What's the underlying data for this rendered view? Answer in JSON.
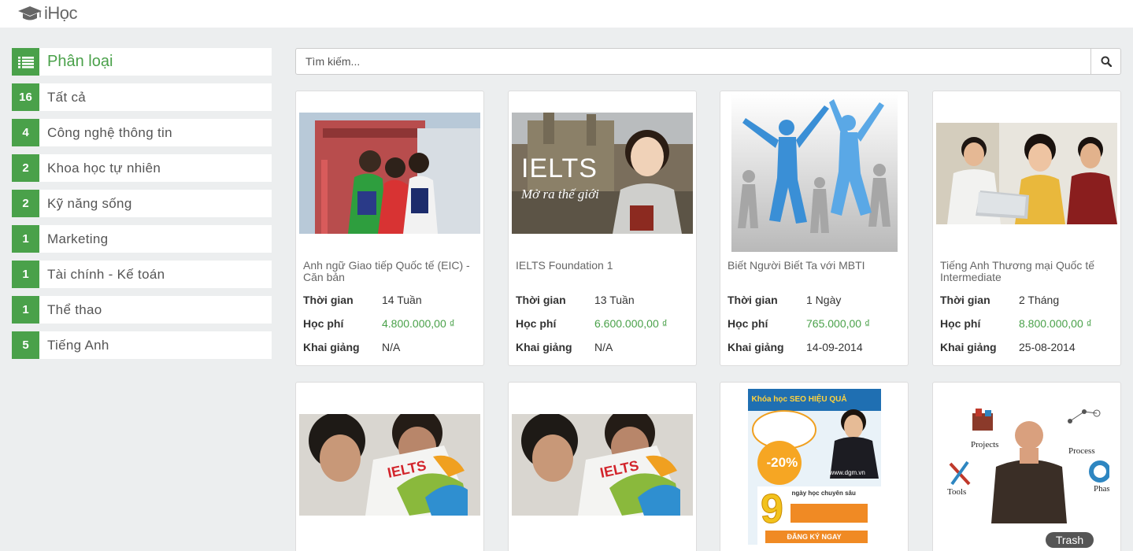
{
  "app": {
    "logo_text": "iHọc"
  },
  "sidebar": {
    "header": "Phân loại",
    "items": [
      {
        "count": "16",
        "label": "Tất cả"
      },
      {
        "count": "4",
        "label": "Công nghệ thông tin"
      },
      {
        "count": "2",
        "label": "Khoa học tự nhiên"
      },
      {
        "count": "2",
        "label": "Kỹ năng sống"
      },
      {
        "count": "1",
        "label": "Marketing"
      },
      {
        "count": "1",
        "label": "Tài chính - Kế toán"
      },
      {
        "count": "1",
        "label": "Thể thao"
      },
      {
        "count": "5",
        "label": "Tiếng Anh"
      }
    ]
  },
  "search": {
    "placeholder": "Tìm kiếm..."
  },
  "labels": {
    "duration": "Thời gian",
    "fee": "Học phí",
    "start": "Khai giảng"
  },
  "courses": [
    {
      "title": "Anh ngữ Giao tiếp Quốc tế (EIC) - Căn bản",
      "duration": "14 Tuần",
      "fee": "4.800.000,00 ₫",
      "start": "N/A",
      "image": "students-group-photo"
    },
    {
      "title": "IELTS Foundation 1",
      "duration": "13 Tuần",
      "fee": "6.600.000,00 ₫",
      "start": "N/A",
      "image": "ielts-banner",
      "image_text": "IELTS",
      "image_subtext": "Mở ra thế giới"
    },
    {
      "title": "Biết Người Biết Ta với MBTI",
      "duration": "1 Ngày",
      "fee": "765.000,00 ₫",
      "start": "14-09-2014",
      "image": "jumping-silhouettes"
    },
    {
      "title": "Tiếng Anh Thương mại Quốc tế Intermediate",
      "duration": "2 Tháng",
      "fee": "8.800.000,00 ₫",
      "start": "25-08-2014",
      "image": "students-laptop-photo"
    },
    {
      "image": "ielts-brochure-photo",
      "brochure_text": "IELTS"
    },
    {
      "image": "ielts-brochure-photo",
      "brochure_text": "IELTS"
    },
    {
      "image": "seo-course-poster",
      "poster_title": "Khóa học SEO HIỆU QUẢ",
      "poster_discount": "-20%",
      "poster_days": "9",
      "poster_sub": "ngày học chuyên sâu",
      "poster_site": "www.dgm.vn",
      "poster_cta": "ĐĂNG KÝ NGAY"
    },
    {
      "image": "projects-process-tools-photo",
      "word_projects": "Projects",
      "word_process": "Process",
      "word_tools": "Tools",
      "word_phases": "Phases"
    }
  ],
  "dock": {
    "trash_label": "Trash"
  },
  "colors": {
    "accent": "#4aa14a",
    "background": "#eceeef"
  }
}
